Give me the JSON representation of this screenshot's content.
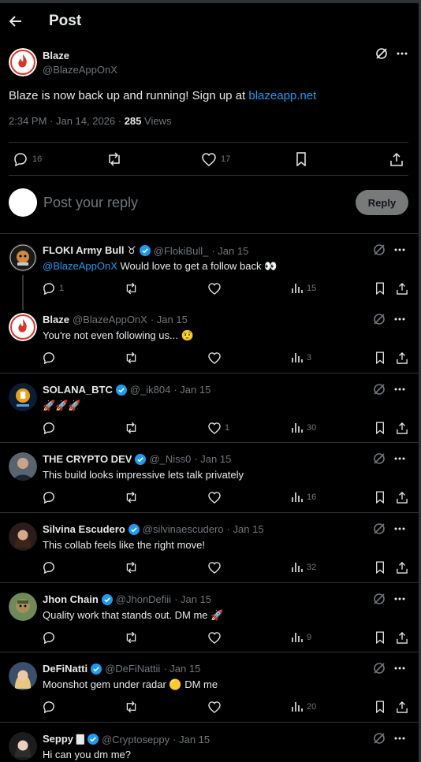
{
  "header": {
    "title": "Post"
  },
  "post": {
    "author_name": "Blaze",
    "author_handle": "@BlazeAppOnX",
    "text": "Blaze is now back up and running! Sign up at ",
    "link": "blazeapp.net",
    "time": "2:34 PM · Jan 14, 2026 · ",
    "views_count": "285",
    "views_label": " Views",
    "replies": "16",
    "likes": "17"
  },
  "reply_box": {
    "placeholder": "Post your reply",
    "button": "Reply"
  },
  "replies": [
    {
      "name": "FLOKI Army Bull ♉",
      "handle": "@FlokiBull_",
      "date": "· Jan 15",
      "mention": "@BlazeAppOnX",
      "text": " Would love to get a follow back 👀",
      "reply_count": "1",
      "like_count": "",
      "views": "15",
      "verified": true
    },
    {
      "name": "Blaze",
      "handle": "@BlazeAppOnX",
      "date": "· Jan 15",
      "mention": "",
      "text": "You're not even following us... 🤨",
      "reply_count": "",
      "like_count": "",
      "views": "3",
      "verified": false
    },
    {
      "name": "SOLANA_BTC",
      "handle": "@_ik804",
      "date": "· Jan 15",
      "mention": "",
      "text": "🚀🚀🚀",
      "reply_count": "",
      "like_count": "1",
      "views": "30",
      "verified": true
    },
    {
      "name": "THE CRYPTO DEV",
      "handle": "@_Niss0",
      "date": "· Jan 15",
      "mention": "",
      "text": "This build looks impressive lets talk privately",
      "reply_count": "",
      "like_count": "",
      "views": "16",
      "verified": true
    },
    {
      "name": "Silvina Escudero",
      "handle": "@silvinaescudero",
      "date": "· Jan 15",
      "mention": "",
      "text": "This collab feels like the right move!",
      "reply_count": "",
      "like_count": "",
      "views": "32",
      "verified": true
    },
    {
      "name": "Jhon Chain",
      "handle": "@JhonDefiii",
      "date": "· Jan 15",
      "mention": "",
      "text": "Quality work that stands out. DM me 🚀",
      "reply_count": "",
      "like_count": "",
      "views": "9",
      "verified": true
    },
    {
      "name": "DeFiNatti",
      "handle": "@DeFiNattii",
      "date": "· Jan 15",
      "mention": "",
      "text": "Moonshot gem under radar 🟡 DM me",
      "reply_count": "",
      "like_count": "",
      "views": "20",
      "verified": true
    },
    {
      "name": "Seppy 🀫",
      "handle": "@Cryptoseppy",
      "date": "· Jan 15",
      "mention": "",
      "text": "Hi can you dm me?",
      "reply_count": "",
      "like_count": "",
      "views": "",
      "verified": true
    }
  ],
  "colors": {
    "accent": "#1d9bf0",
    "text": "#e7e9ea",
    "muted": "#71767b",
    "border": "#2f3336"
  }
}
